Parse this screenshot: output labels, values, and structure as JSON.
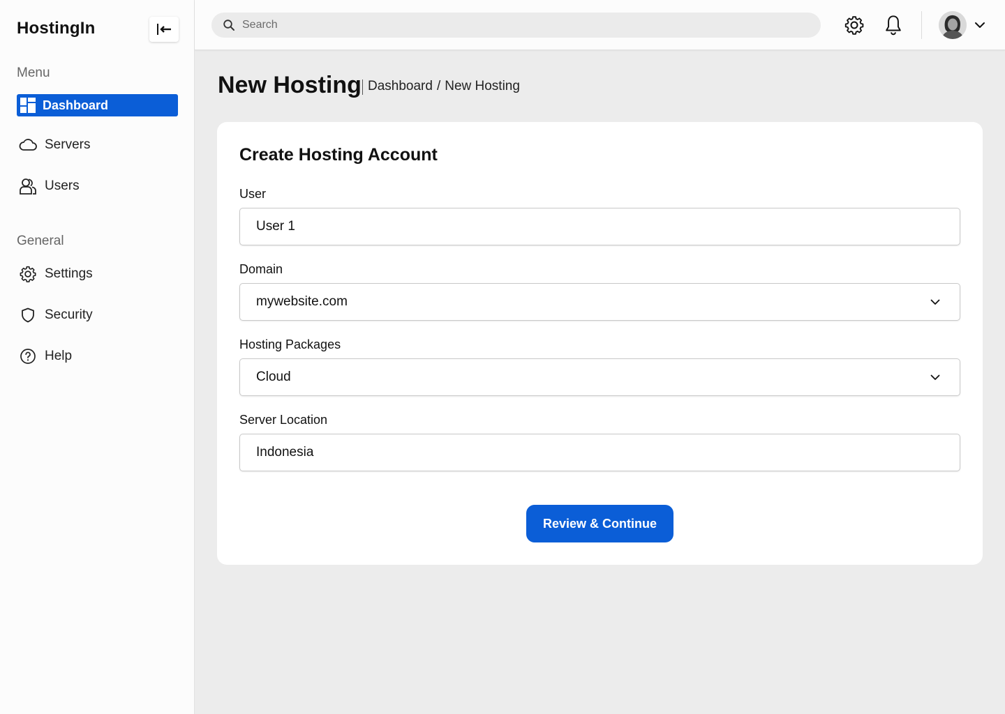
{
  "app": {
    "brand": "HostingIn"
  },
  "sidebar": {
    "menu_title": "Menu",
    "menu_items": [
      {
        "label": "Dashboard",
        "icon": "dashboard-icon",
        "active": true
      },
      {
        "label": "Servers",
        "icon": "cloud-icon"
      },
      {
        "label": "Users",
        "icon": "users-icon"
      }
    ],
    "general_title": "General",
    "general_items": [
      {
        "label": "Settings",
        "icon": "gear-icon"
      },
      {
        "label": "Security",
        "icon": "shield-icon"
      },
      {
        "label": "Help",
        "icon": "help-circle-icon"
      }
    ]
  },
  "header": {
    "search_placeholder": "Search",
    "icons": [
      "search-icon",
      "gear-icon",
      "bell-icon",
      "avatar",
      "chevron-down-icon"
    ]
  },
  "page": {
    "title": "New Hosting",
    "breadcrumb": [
      "Dashboard",
      "/",
      "New Hosting"
    ]
  },
  "form": {
    "title": "Create Hosting Account",
    "fields": [
      {
        "label": "User",
        "value": "User 1",
        "type": "input"
      },
      {
        "label": "Domain",
        "value": "mywebsite.com",
        "type": "select"
      },
      {
        "label": "Hosting Packages",
        "value": "Cloud",
        "type": "select"
      },
      {
        "label": "Server Location",
        "value": "Indonesia",
        "type": "input"
      }
    ],
    "submit_label": "Review & Continue"
  },
  "colors": {
    "accent": "#0b5ed7",
    "page_bg": "#ececec",
    "surface": "#ffffff"
  }
}
